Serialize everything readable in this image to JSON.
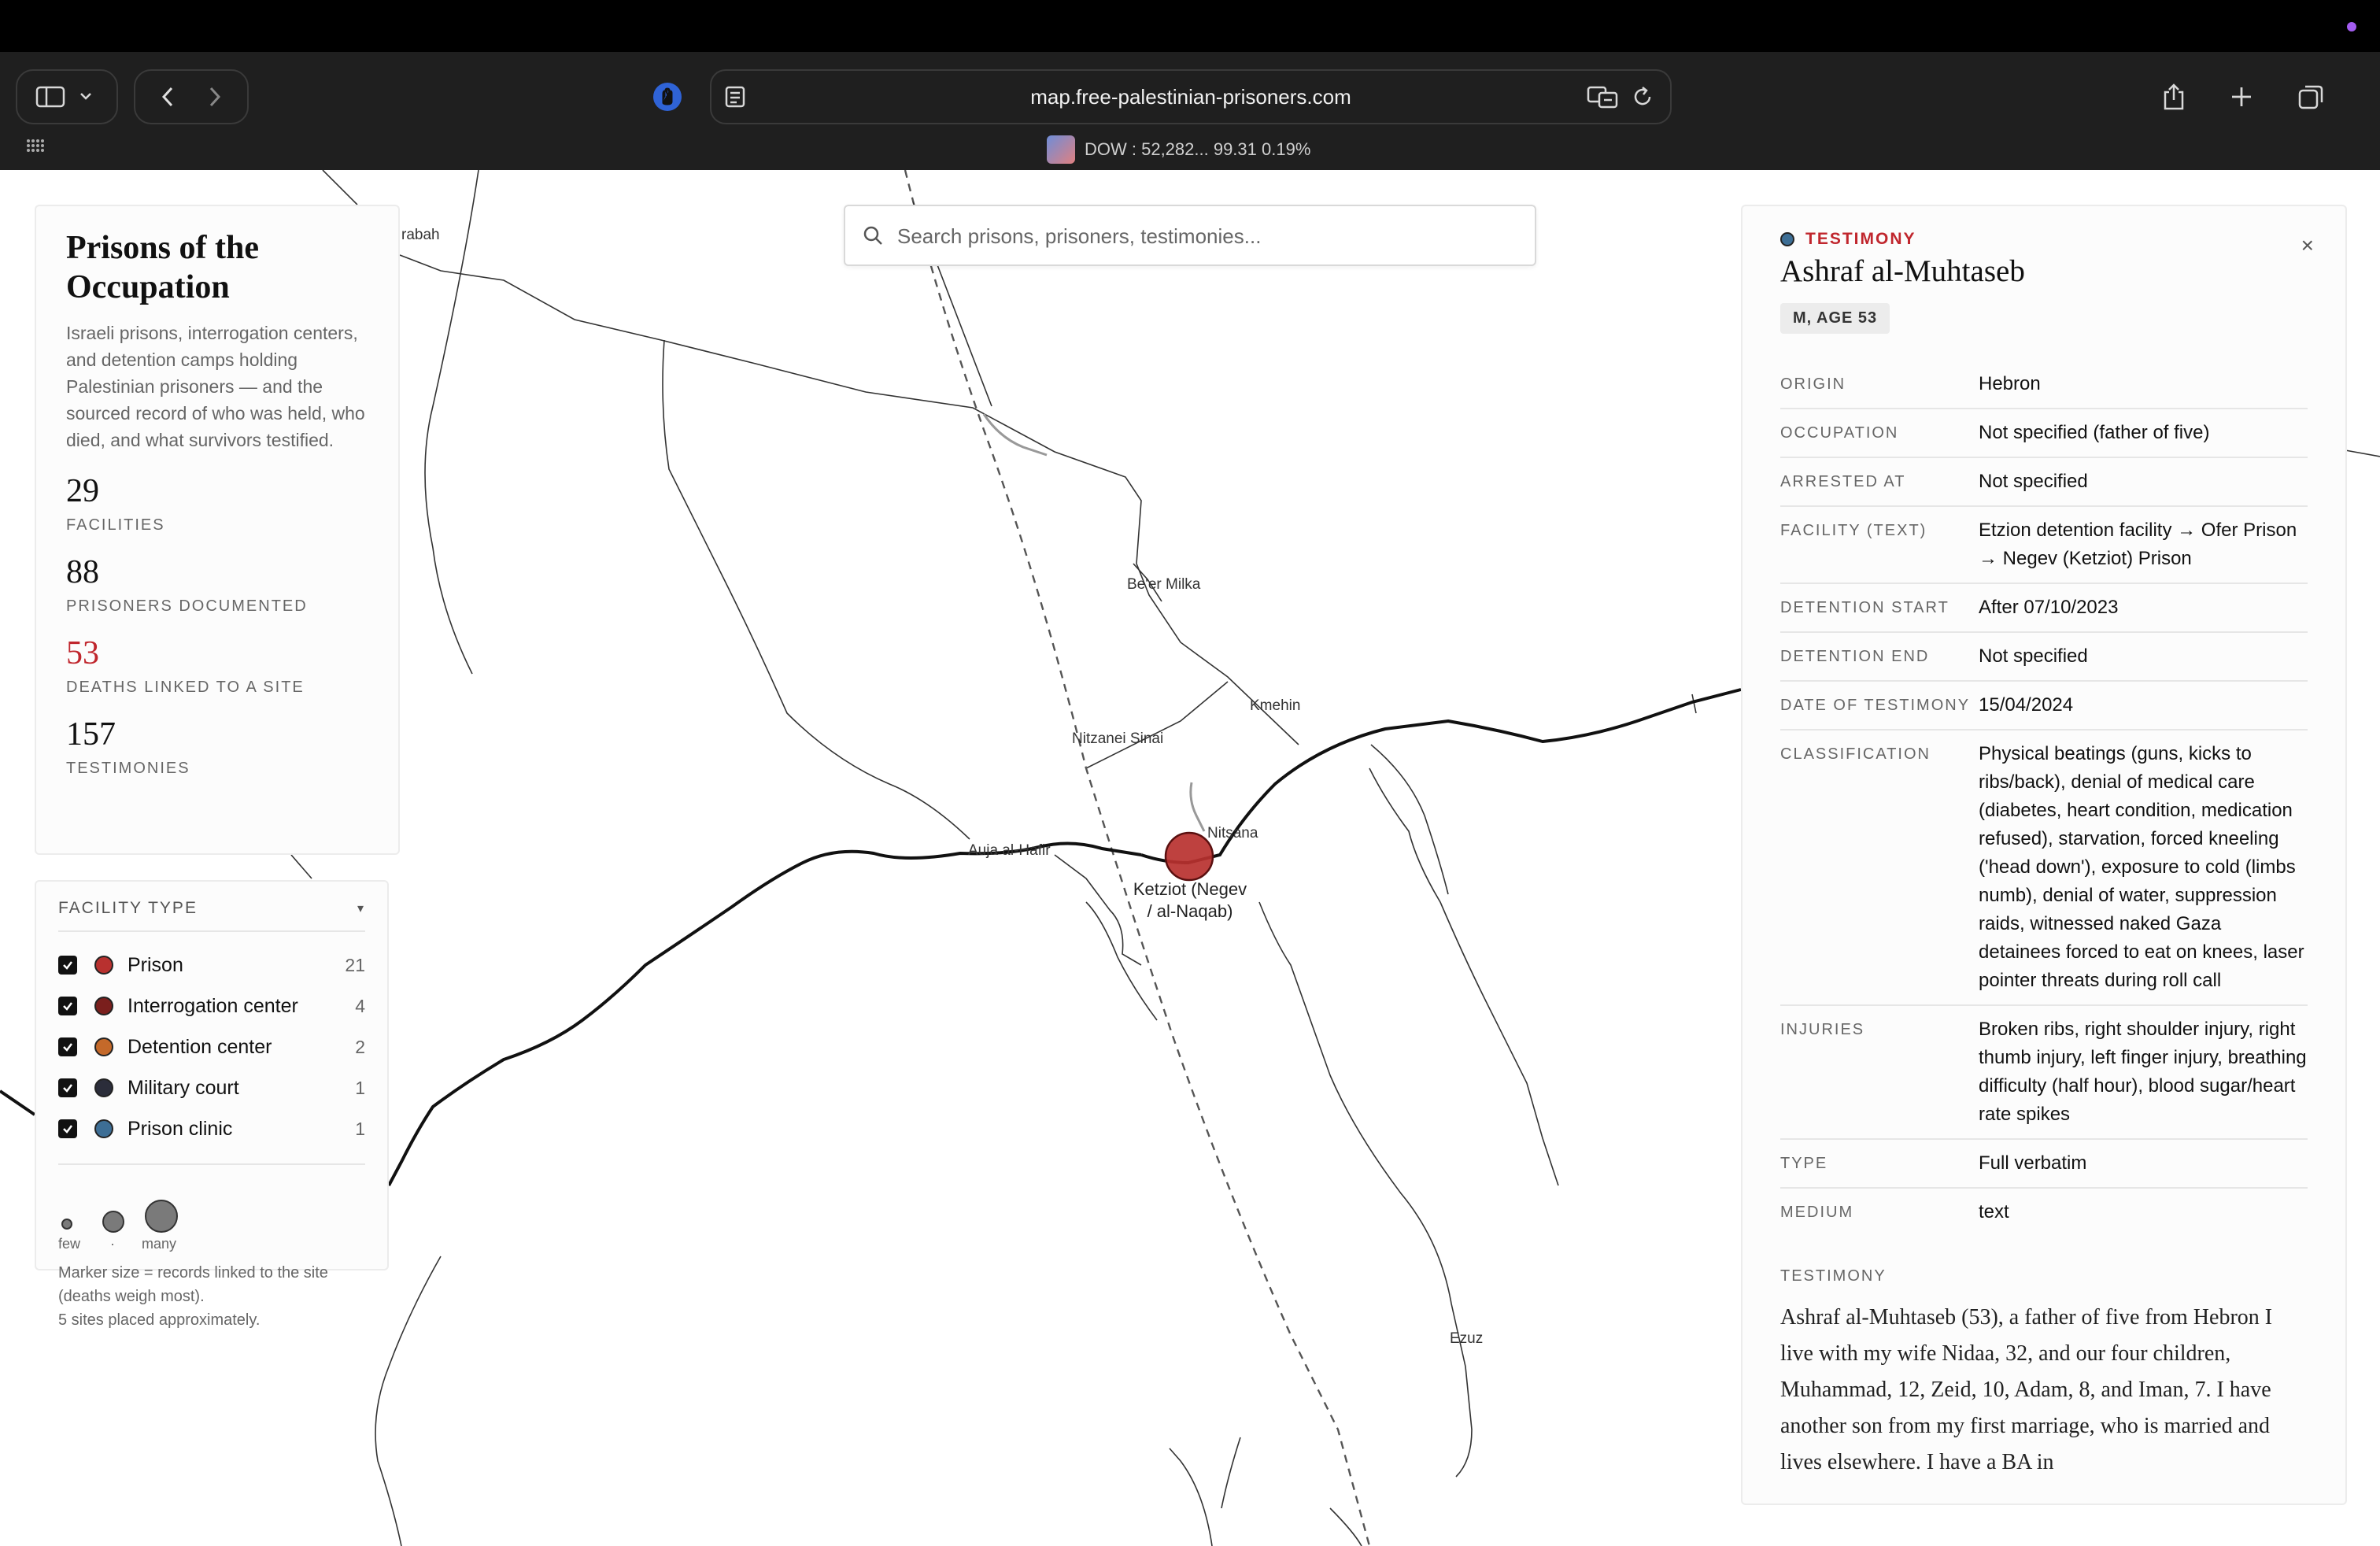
{
  "browser": {
    "url": "map.free-palestinian-prisoners.com",
    "tab_title": "DOW : 52,282... 99.31 0.19%"
  },
  "search": {
    "placeholder": "Search prisons, prisoners, testimonies..."
  },
  "stats": {
    "title": "Prisons of the Occupation",
    "description": "Israeli prisons, interrogation centers, and detention camps holding Palestinian prisoners — and the sourced record of who was held, who died, and what survivors testified.",
    "items": [
      {
        "value": "29",
        "label": "FACILITIES"
      },
      {
        "value": "88",
        "label": "PRISONERS DOCUMENTED"
      },
      {
        "value": "53",
        "label": "DEATHS LINKED TO A SITE"
      },
      {
        "value": "157",
        "label": "TESTIMONIES"
      }
    ]
  },
  "legend": {
    "title": "FACILITY TYPE",
    "caret": "▾",
    "items": [
      {
        "label": "Prison",
        "count": "21",
        "color": "#b8312f"
      },
      {
        "label": "Interrogation center",
        "count": "4",
        "color": "#7a1f1d"
      },
      {
        "label": "Detention center",
        "count": "2",
        "color": "#c4692a"
      },
      {
        "label": "Military court",
        "count": "1",
        "color": "#2b2d3a"
      },
      {
        "label": "Prison clinic",
        "count": "1",
        "color": "#3d6e95"
      }
    ],
    "size_few": "few",
    "size_mid": "·",
    "size_many": "many",
    "note_line1": "Marker size = records linked to the site (deaths weigh most).",
    "note_line2": "5 sites placed approximately."
  },
  "map": {
    "labels": {
      "rabah": "rabah",
      "beer_milka": "Be'er Milka",
      "kmehin": "Kmehin",
      "nitzanei_sinai": "Nitzanei Sinai",
      "nitsana": "Nitsana",
      "auja": "Auja al-Hafir",
      "ketziot_1": "Ketziot (Negev",
      "ketziot_2": "/ al-Naqab)",
      "ezuz": "Ezuz"
    },
    "marker_color": "#b8312f"
  },
  "detail": {
    "kind": "TESTIMONY",
    "name": "Ashraf al-Muhtaseb",
    "badge": "M, AGE 53",
    "close": "×",
    "fields": [
      {
        "key": "ORIGIN",
        "value": "Hebron"
      },
      {
        "key": "OCCUPATION",
        "value": "Not specified (father of five)"
      },
      {
        "key": "ARRESTED AT",
        "value": "Not specified"
      },
      {
        "key": "FACILITY (TEXT)",
        "value": "Etzion detention facility → Ofer Prison → Negev (Ketziot) Prison"
      },
      {
        "key": "DETENTION START",
        "value": "After 07/10/2023"
      },
      {
        "key": "DETENTION END",
        "value": "Not specified"
      },
      {
        "key": "DATE OF TESTIMONY",
        "value": "15/04/2024"
      },
      {
        "key": "CLASSIFICATION",
        "value": "Physical beatings (guns, kicks to ribs/back), denial of medical care (diabetes, heart condition, medication refused), starvation, forced kneeling ('head down'), exposure to cold (limbs numb), denial of water, suppression raids, witnessed naked Gaza detainees forced to eat on knees, laser pointer threats during roll call"
      },
      {
        "key": "INJURIES",
        "value": "Broken ribs, right shoulder injury, right thumb injury, left finger injury, breathing difficulty (half hour), blood sugar/heart rate spikes"
      },
      {
        "key": "TYPE",
        "value": "Full verbatim"
      },
      {
        "key": "MEDIUM",
        "value": "text"
      }
    ],
    "testimony_heading": "TESTIMONY",
    "testimony_text": "Ashraf al-Muhtaseb (53), a father of five from Hebron I live with my wife Nidaa, 32, and our four children, Muhammad, 12, Zeid, 10, Adam, 8, and Iman, 7. I have another son from my first marriage, who is married and lives elsewhere. I have a BA in"
  }
}
